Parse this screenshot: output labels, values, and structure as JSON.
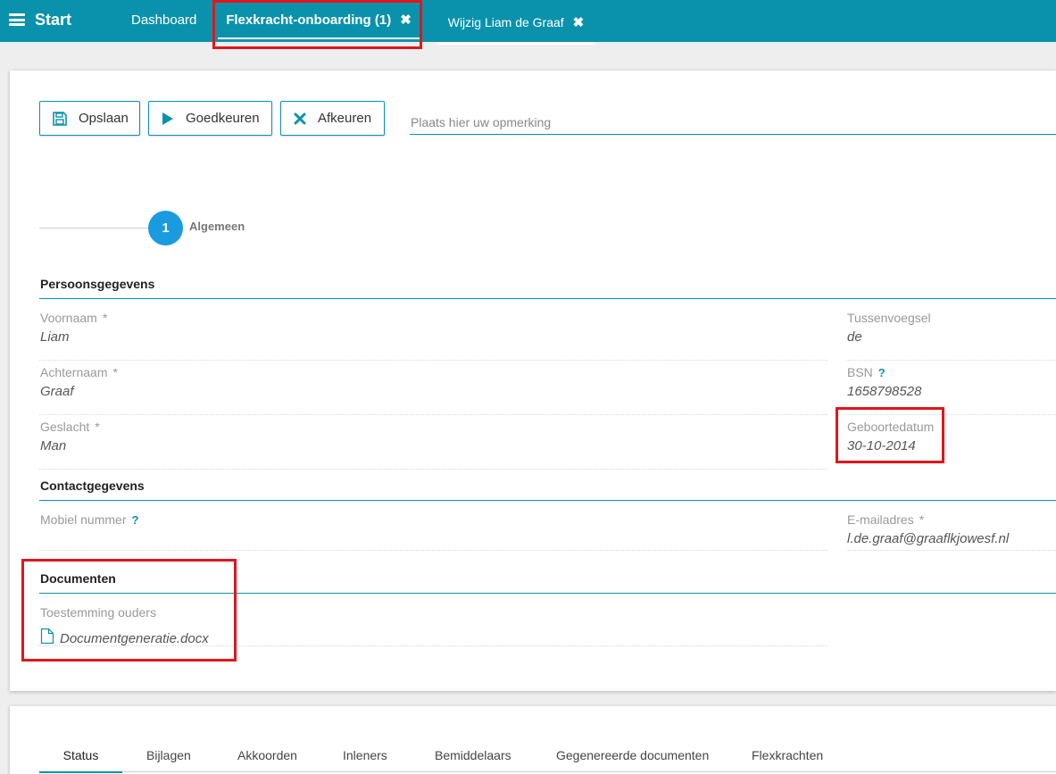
{
  "topbar": {
    "start_label": "Start",
    "tabs": [
      {
        "label": "Dashboard"
      },
      {
        "label": "Flexkracht-onboarding (1)"
      },
      {
        "label": "Wijzig Liam de Graaf"
      }
    ],
    "colors": {
      "bar": "#0a92ac",
      "highlight": "#e0161c"
    }
  },
  "toolbar": {
    "save_label": "Opslaan",
    "approve_label": "Goedkeuren",
    "reject_label": "Afkeuren",
    "remark_placeholder": "Plaats hier uw opmerking"
  },
  "steps": [
    {
      "number": "1",
      "label": "Algemeen"
    }
  ],
  "persoonsgegevens": {
    "title": "Persoonsgegevens",
    "voornaam": {
      "label": "Voornaam",
      "required": "*",
      "value": "Liam"
    },
    "tussenvoegsel": {
      "label": "Tussenvoegsel",
      "value": "de"
    },
    "achternaam": {
      "label": "Achternaam",
      "required": "*",
      "value": "Graaf"
    },
    "bsn": {
      "label": "BSN",
      "help": "?",
      "value": "1658798528"
    },
    "geslacht": {
      "label": "Geslacht",
      "required": "*",
      "value": "Man"
    },
    "geboortedatum": {
      "label": "Geboortedatum",
      "value": "30-10-2014"
    }
  },
  "contactgegevens": {
    "title": "Contactgegevens",
    "mobiel": {
      "label": "Mobiel nummer",
      "help": "?",
      "value": ""
    },
    "email": {
      "label": "E-mailadres",
      "required": "*",
      "value": "l.de.graaf@graaflkjowesf.nl"
    }
  },
  "documenten": {
    "title": "Documenten",
    "toestemming": {
      "label": "Toestemming ouders",
      "file": "Documentgeneratie.docx"
    }
  },
  "bottom_tabs": [
    {
      "label": "Status",
      "active": true
    },
    {
      "label": "Bijlagen"
    },
    {
      "label": "Akkoorden"
    },
    {
      "label": "Inleners"
    },
    {
      "label": "Bemiddelaars"
    },
    {
      "label": "Gegenereerde documenten"
    },
    {
      "label": "Flexkrachten"
    }
  ]
}
